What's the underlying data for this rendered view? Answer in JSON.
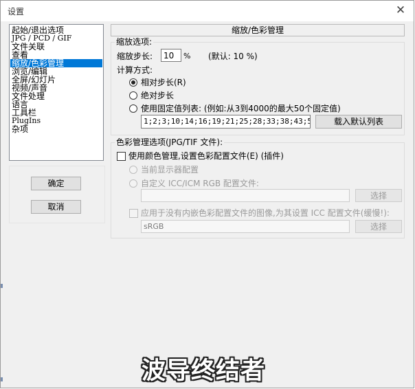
{
  "window": {
    "title": "设置",
    "close_label": "✕"
  },
  "nav": {
    "items": [
      {
        "label": "起始/退出选项",
        "selected": false
      },
      {
        "label": "JPG / PCD / GIF",
        "selected": false
      },
      {
        "label": "文件关联",
        "selected": false
      },
      {
        "label": "查看",
        "selected": false
      },
      {
        "label": "缩放/色彩管理",
        "selected": true
      },
      {
        "label": "浏览/编辑",
        "selected": false
      },
      {
        "label": "全屏/幻灯片",
        "selected": false
      },
      {
        "label": "视频/声音",
        "selected": false
      },
      {
        "label": "文件处理",
        "selected": false
      },
      {
        "label": "语言",
        "selected": false
      },
      {
        "label": "工具栏",
        "selected": false
      },
      {
        "label": "PlugIns",
        "selected": false
      },
      {
        "label": "杂项",
        "selected": false
      }
    ],
    "ok_label": "确定",
    "cancel_label": "取消"
  },
  "main": {
    "section_title": "缩放/色彩管理",
    "zoom": {
      "group_label": "缩放选项:",
      "step_label": "缩放步长:",
      "step_value": "10",
      "step_unit": "%",
      "default_note": "(默认: 10 %)",
      "calc_label": "计算方式:",
      "radio_relative": "相对步长(R)",
      "radio_absolute": "绝对步长",
      "radio_fixed": "使用固定值列表: (例如:从3到4000的最大50个固定值)",
      "selected_method": "relative",
      "list_value": "1;2;3;10;14;16;19;21;25;28;33;38;43;50;5",
      "load_default_label": "载入默认列表"
    },
    "color": {
      "group_label": "色彩管理选项(JPG/TIF 文件):",
      "use_cm_label": "使用颜色管理,设置色彩配置文件(E) (插件)",
      "radio_display": "当前显示器配置",
      "radio_custom": "自定义 ICC/ICM RGB 配置文件:",
      "custom_file_value": "",
      "select_label_1": "选择",
      "apply_no_embedded_label": "应用于没有内嵌色彩配置文件的图像,为其设置 ICC 配置文件(缓慢!):",
      "srgb_value": "sRGB",
      "select_label_2": "选择"
    }
  },
  "watermark": "波导终结者"
}
